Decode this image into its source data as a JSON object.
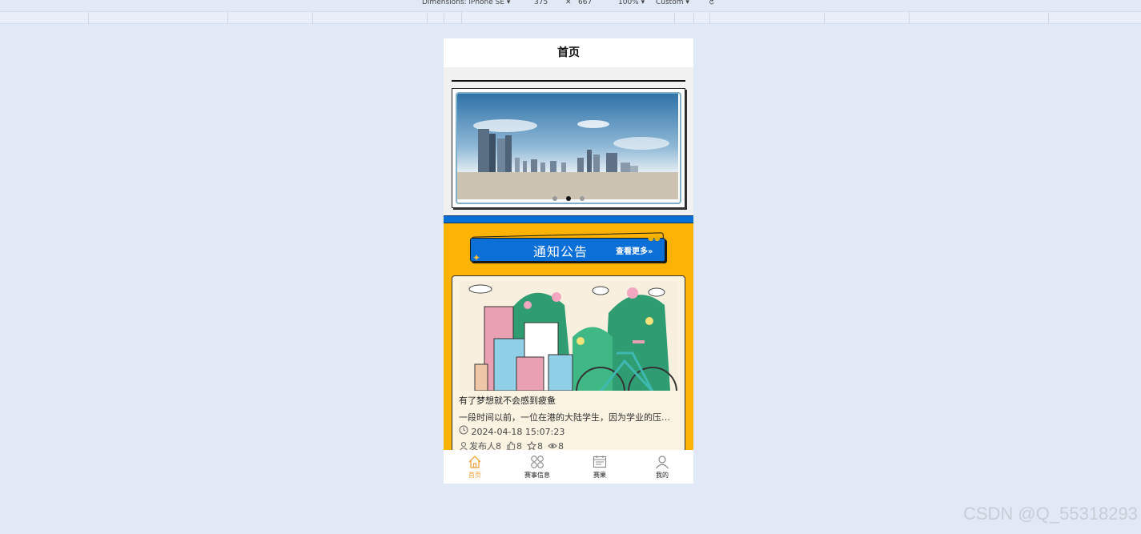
{
  "devtools": {
    "dimensions_label": "Dimensions: iPhone SE ▾",
    "width": "375",
    "times": "✕",
    "height": "667",
    "zoom": "100% ▾",
    "throttle": "Custom ▾"
  },
  "page": {
    "title": "首页"
  },
  "swiper": {
    "dot_count": 3,
    "active_index": 1
  },
  "notice": {
    "title": "通知公告",
    "more": "查看更多»"
  },
  "news": {
    "title": "有了梦想就不会感到疲惫",
    "description": "一段时间以前，一位在港的大陆学生，因为学业的压力和生活的困扰",
    "time": "2024-04-18 15:07:23",
    "publisher": "发布人8",
    "likes": "8",
    "favorites": "8",
    "views": "8"
  },
  "tabbar": {
    "items": [
      {
        "label": "首页",
        "icon": "home-icon",
        "active": true
      },
      {
        "label": "赛事信息",
        "icon": "grid-icon",
        "active": false
      },
      {
        "label": "赛果",
        "icon": "calendar-icon",
        "active": false
      },
      {
        "label": "我的",
        "icon": "user-icon",
        "active": false
      }
    ]
  },
  "watermark": "CSDN @Q_55318293",
  "colors": {
    "background": "#e1e9f6",
    "notice_blue": "#0b6fd8",
    "section_yellow": "#fdb306",
    "tab_active": "#f0a23e"
  }
}
